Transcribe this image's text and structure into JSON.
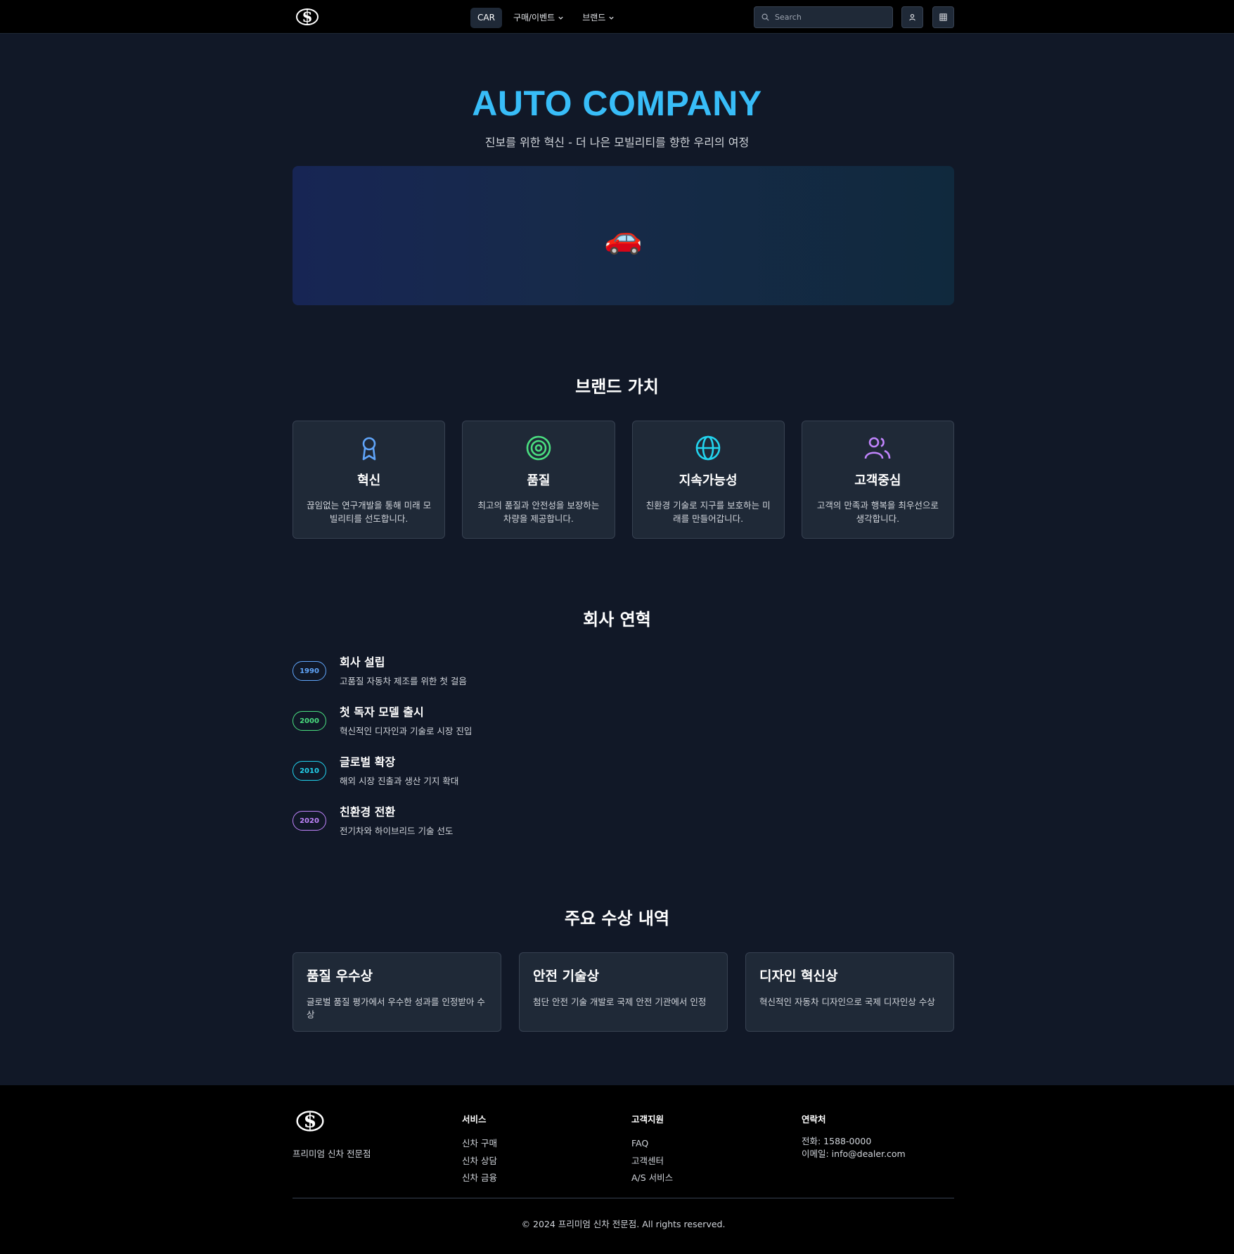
{
  "nav": {
    "logo_icon": "dollar-crest-logo",
    "items": [
      {
        "label": "CAR",
        "active": true
      },
      {
        "label": "구매/이벤트",
        "dropdown": true
      },
      {
        "label": "브랜드",
        "dropdown": true
      }
    ],
    "search_placeholder": "Search"
  },
  "hero": {
    "title": "AUTO COMPANY",
    "subtitle": "진보를 위한 혁신 - 더 나은 모빌리티를 향한 우리의 여정",
    "banner_emoji": "🚗"
  },
  "values": {
    "title": "브랜드 가치",
    "items": [
      {
        "icon": "award-icon",
        "color": "#60a5fa",
        "title": "혁신",
        "desc": "끊임없는 연구개발을 통해 미래 모빌리티를 선도합니다."
      },
      {
        "icon": "target-icon",
        "color": "#4ade80",
        "title": "품질",
        "desc": "최고의 품질과 안전성을 보장하는 차량을 제공합니다."
      },
      {
        "icon": "globe-icon",
        "color": "#22d3ee",
        "title": "지속가능성",
        "desc": "친환경 기술로 지구를 보호하는 미래를 만들어갑니다."
      },
      {
        "icon": "users-icon",
        "color": "#c084fc",
        "title": "고객중심",
        "desc": "고객의 만족과 행복을 최우선으로 생각합니다."
      }
    ]
  },
  "history": {
    "title": "회사 연혁",
    "items": [
      {
        "year": "1990",
        "color": "#60a5fa",
        "title": "회사 설립",
        "desc": "고품질 자동차 제조를 위한 첫 걸음"
      },
      {
        "year": "2000",
        "color": "#4ade80",
        "title": "첫 독자 모델 출시",
        "desc": "혁신적인 디자인과 기술로 시장 진입"
      },
      {
        "year": "2010",
        "color": "#22d3ee",
        "title": "글로벌 확장",
        "desc": "해외 시장 진출과 생산 기지 확대"
      },
      {
        "year": "2020",
        "color": "#c084fc",
        "title": "친환경 전환",
        "desc": "전기차와 하이브리드 기술 선도"
      }
    ]
  },
  "awards": {
    "title": "주요 수상 내역",
    "items": [
      {
        "title": "품질 우수상",
        "desc": "글로벌 품질 평가에서 우수한 성과를 인정받아 수상"
      },
      {
        "title": "안전 기술상",
        "desc": "첨단 안전 기술 개발로 국제 안전 기관에서 인정"
      },
      {
        "title": "디자인 혁신상",
        "desc": "혁신적인 자동차 디자인으로 국제 디자인상 수상"
      }
    ]
  },
  "footer": {
    "tagline": "프리미엄 신차 전문점",
    "services": {
      "title": "서비스",
      "links": [
        "신차 구매",
        "신차 상담",
        "신차 금융"
      ]
    },
    "support": {
      "title": "고객지원",
      "links": [
        "FAQ",
        "고객센터",
        "A/S 서비스"
      ]
    },
    "contact": {
      "title": "연락처",
      "phone": "전화: 1588-0000",
      "email": "이메일: info@dealer.com"
    },
    "copyright": "© 2024 프리미엄 신차 전문점. All rights reserved."
  },
  "colors": {
    "accent": "#38bdf8",
    "background": "#111827",
    "card": "#1f2937",
    "nav": "#000000"
  }
}
